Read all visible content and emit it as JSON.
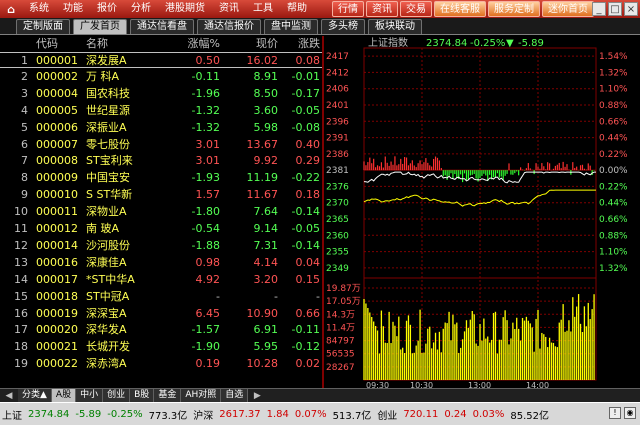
{
  "menubar": {
    "logo": "⌂",
    "items": [
      "系统",
      "功能",
      "报价",
      "分析",
      "港股期货",
      "资讯",
      "工具",
      "帮助"
    ],
    "quick_buttons": [
      "行情",
      "资讯",
      "交易",
      "在线客服",
      "服务定制",
      "迷你首页"
    ],
    "window_controls": [
      "_",
      "□",
      "×"
    ]
  },
  "tabs": [
    "定制版面",
    "广发首页",
    "通达信看盘",
    "通达信报价",
    "盘中监测",
    "多头榜",
    "板块联动"
  ],
  "active_tab": 1,
  "table": {
    "headers": {
      "code": "代码",
      "name": "名称",
      "pct": "涨幅%",
      "price": "现价",
      "chg": "涨跌"
    },
    "rows": [
      {
        "idx": "1",
        "code": "000001",
        "name": "深发展A",
        "pct": "0.50",
        "price": "16.02",
        "chg": "0.08",
        "dir": "up"
      },
      {
        "idx": "2",
        "code": "000002",
        "name": "万  科A",
        "pct": "-0.11",
        "price": "8.91",
        "chg": "-0.01",
        "dir": "down"
      },
      {
        "idx": "3",
        "code": "000004",
        "name": "国农科技",
        "pct": "-1.96",
        "price": "8.50",
        "chg": "-0.17",
        "dir": "down"
      },
      {
        "idx": "4",
        "code": "000005",
        "name": "世纪星源",
        "pct": "-1.32",
        "price": "3.60",
        "chg": "-0.05",
        "dir": "down"
      },
      {
        "idx": "5",
        "code": "000006",
        "name": "深振业A",
        "pct": "-1.32",
        "price": "5.98",
        "chg": "-0.08",
        "dir": "down"
      },
      {
        "idx": "6",
        "code": "000007",
        "name": "零七股份",
        "pct": "3.01",
        "price": "13.67",
        "chg": "0.40",
        "dir": "up"
      },
      {
        "idx": "7",
        "code": "000008",
        "name": "ST宝利来",
        "pct": "3.01",
        "price": "9.92",
        "chg": "0.29",
        "dir": "up"
      },
      {
        "idx": "8",
        "code": "000009",
        "name": "中国宝安",
        "pct": "-1.93",
        "price": "11.19",
        "chg": "-0.22",
        "dir": "down"
      },
      {
        "idx": "9",
        "code": "000010",
        "name": "S ST华新",
        "pct": "1.57",
        "price": "11.67",
        "chg": "0.18",
        "dir": "up"
      },
      {
        "idx": "10",
        "code": "000011",
        "name": "深物业A",
        "pct": "-1.80",
        "price": "7.64",
        "chg": "-0.14",
        "dir": "down"
      },
      {
        "idx": "11",
        "code": "000012",
        "name": "南  玻A",
        "pct": "-0.54",
        "price": "9.14",
        "chg": "-0.05",
        "dir": "down"
      },
      {
        "idx": "12",
        "code": "000014",
        "name": "沙河股份",
        "pct": "-1.88",
        "price": "7.31",
        "chg": "-0.14",
        "dir": "down"
      },
      {
        "idx": "13",
        "code": "000016",
        "name": "深康佳A",
        "pct": "0.98",
        "price": "4.14",
        "chg": "0.04",
        "dir": "up"
      },
      {
        "idx": "14",
        "code": "000017",
        "name": "*ST中华A",
        "pct": "4.92",
        "price": "3.20",
        "chg": "0.15",
        "dir": "up"
      },
      {
        "idx": "15",
        "code": "000018",
        "name": "ST中冠A",
        "pct": "-",
        "price": "-",
        "chg": "-",
        "dir": "none"
      },
      {
        "idx": "16",
        "code": "000019",
        "name": "深深宝A",
        "pct": "6.45",
        "price": "10.90",
        "chg": "0.66",
        "dir": "up"
      },
      {
        "idx": "17",
        "code": "000020",
        "name": "深华发A",
        "pct": "-1.57",
        "price": "6.91",
        "chg": "-0.11",
        "dir": "down"
      },
      {
        "idx": "18",
        "code": "000021",
        "name": "长城开发",
        "pct": "-1.90",
        "price": "5.95",
        "chg": "-0.12",
        "dir": "down"
      },
      {
        "idx": "19",
        "code": "000022",
        "name": "深赤湾A",
        "pct": "0.19",
        "price": "10.28",
        "chg": "0.02",
        "dir": "up"
      }
    ]
  },
  "chart": {
    "title": "上证指数",
    "value": "2374.84",
    "pct": "-0.25%",
    "arrow": "▼",
    "chg": "-5.89",
    "price_labels_left": [
      "2417",
      "2412",
      "2406",
      "2401",
      "2396",
      "2391",
      "2386",
      "2381",
      "2376",
      "2370",
      "2365",
      "2360",
      "2355",
      "2349"
    ],
    "price_labels_right": [
      "1.54%",
      "1.32%",
      "1.10%",
      "0.88%",
      "0.66%",
      "0.44%",
      "0.22%",
      "0.00%",
      "0.22%",
      "0.44%",
      "0.66%",
      "0.88%",
      "1.10%",
      "1.32%"
    ],
    "volume_labels": [
      "19.87万",
      "17.05万",
      "14.2万",
      "11.4万",
      "8.52万",
      "6.65万",
      "5.65万",
      "2.84万"
    ],
    "volume_labels_display": [
      "19.87万",
      "17.05万",
      "14.3万",
      "11.4万",
      "84797",
      "56535",
      "28267"
    ],
    "time_labels": [
      "09:30",
      "10:30",
      "13:00",
      "14:00"
    ],
    "base_label": "2381",
    "colors": {
      "up": "#ff3030",
      "down": "#30ff30",
      "index_line": "#ffffff",
      "avg_line": "#ffff00",
      "volume": "#ffff00",
      "grid": "#800000"
    }
  },
  "bottom_tabs": [
    "分类▲",
    "A股",
    "中小",
    "创业",
    "B股",
    "基金",
    "AH对照",
    "自选"
  ],
  "bottom_active": 1,
  "bottom_nav": [
    "◀",
    "▶"
  ],
  "status": {
    "sh_label": "上证",
    "sh_value": "2374.84",
    "sh_chg": "-5.89",
    "sh_pct": "-0.25%",
    "sh_amount": "773.3亿",
    "hs_label": "沪深",
    "hs_value": "2617.37",
    "hs_chg": "1.84",
    "hs_pct": "0.07%",
    "hs_amount": "513.7亿",
    "cy_label": "创业",
    "cy_value": "720.11",
    "cy_chg": "0.24",
    "cy_pct": "0.03%",
    "cy_amount": "85.52亿"
  }
}
